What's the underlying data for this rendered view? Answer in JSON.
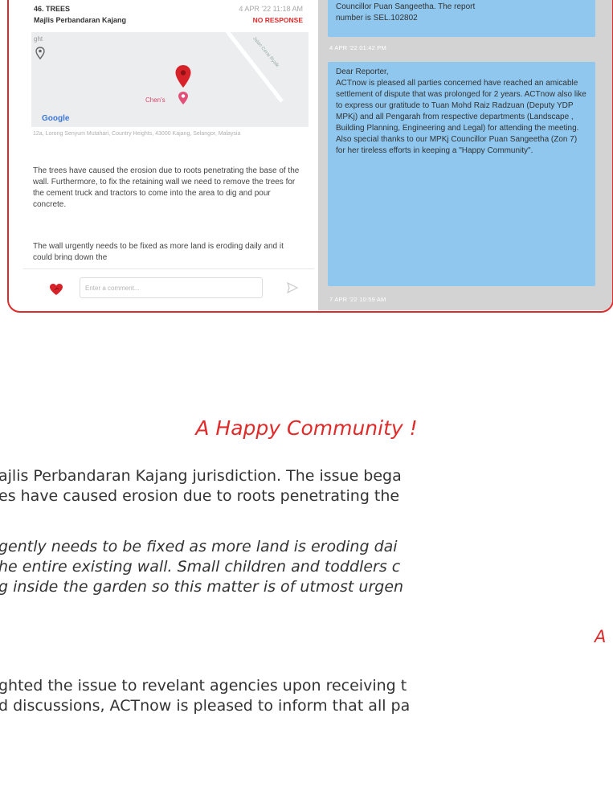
{
  "report": {
    "id_title": "46. TREES",
    "council": "Majlis Perbandaran Kajang",
    "timestamp": "4 APR '22 11:18 AM",
    "status": "NO RESPONSE",
    "map": {
      "corner_label": "ght",
      "road_label": "Jalan Cerai Ryalk",
      "poi_label": "Chen's",
      "logo": "Google"
    },
    "address": "12a, Lorong Senyum Mutahari, Country Heights, 43000 Kajang, Selangor, Malaysia",
    "description": "The trees have caused the erosion due to roots penetrating the base of the wall. Furthermore, to fix the retaining wall we need to remove the trees for the cement truck and tractors to come into the area to dig and pour concrete.",
    "description2": "The wall urgently needs to be fixed as more land is eroding daily and it could bring down the",
    "comment_placeholder": "Enter a comment...",
    "icons": {
      "like": "heart-icon",
      "send": "send-icon",
      "pin": "map-pin-icon"
    },
    "colors": {
      "accent": "#e02b2b",
      "bubble": "#8fc7ee",
      "chat_bg": "#d3d3d3"
    }
  },
  "chat": {
    "bubble1_line1": "Councillor Puan Sangeetha. The report",
    "bubble1_line2": "number is SEL.102802",
    "time1": "4 APR '22 01:42 PM",
    "bubble2_greeting": "Dear Reporter,",
    "bubble2_body": "ACTnow is pleased all parties concerned have reached an amicable settlement of dispute that was prolonged for 2 years. ACTnow also like to express our gratitude to Tuan Mohd Raiz Radzuan (Deputy YDP MPKj) and all Pengarah from  respective departments (Landscape , Building Planning, Engineering and Legal) for attending the meeting. Also special thanks to our MPKj Councillor Puan Sangeetha (Zon 7) for her tireless efforts in keeping a \"Happy Community\".",
    "time2": "7 APR '22 10:59 AM"
  },
  "article": {
    "heading": "A Happy Community !",
    "para1_line1": "ajlis Perbandaran Kajang jurisdiction. The issue bega",
    "para1_line2": "es have caused erosion due to roots penetrating the",
    "quote_line1": "gently needs to be fixed as more land is eroding dai",
    "quote_line2": "he entire existing wall. Small children and toddlers c",
    "quote_line3": "g inside the garden so this matter is of utmost urgen",
    "red_letter": "A",
    "para2_line1": "ghted the issue to revelant agencies upon receiving t",
    "para2_line2": "d discussions, ACTnow is pleased to inform that all pa"
  }
}
